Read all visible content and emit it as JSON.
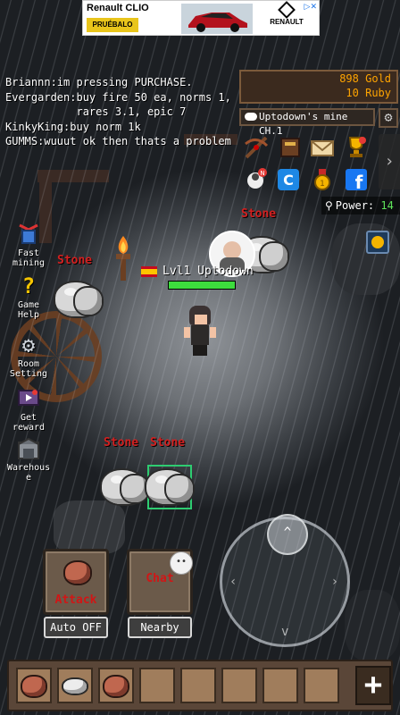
{
  "ad": {
    "brand_prefix": "Renault",
    "brand_model": "CLIO",
    "cta": "PRUÉBALO",
    "logo_text": "RENAULT"
  },
  "chat": {
    "lines": [
      "Briannn:im pressing PURCHASE.",
      "Evergarden:buy fire 50 ea, norms 1,",
      "           rares 3.1, epic 7",
      "KinkyKing:buy norm 1k",
      "GUMMS:wuuut ok then thats a problem"
    ]
  },
  "resources": {
    "gold": "898 Gold",
    "ruby": "10 Ruby"
  },
  "mine": {
    "name": "Uptodown's mine CH.1"
  },
  "power": {
    "label": "Power:",
    "value": "14"
  },
  "left_menu": [
    {
      "label": "Fast\nmining",
      "icon": "pickaxe-cube-icon"
    },
    {
      "label": "Game\nHelp",
      "icon": "question-mark-icon"
    },
    {
      "label": "Room\nSetting",
      "icon": "gear-icon"
    },
    {
      "label": "Get\nreward",
      "icon": "reward-video-icon"
    },
    {
      "label": "Warehous\ne",
      "icon": "warehouse-icon"
    }
  ],
  "top_icons": [
    "crossbow-icon",
    "book-icon",
    "mail-icon",
    "trophy-icon",
    "notification-icon",
    "c-badge-icon",
    "medal-icon",
    "facebook-icon"
  ],
  "map": {
    "stone_label": "Stone",
    "nameplate": "Lvl1 Uptodown",
    "hp_fraction": 1.0
  },
  "actions": {
    "attack_label": "Attack",
    "chat_label": "Chat",
    "auto_label": "Auto OFF",
    "nearby_label": "Nearby"
  },
  "hotbar": {
    "slots": [
      "red-ore",
      "white-stone",
      "red-ore",
      "",
      "",
      "",
      "",
      ""
    ],
    "plus": "+"
  },
  "colors": {
    "gold": "#ffa400",
    "stone_label": "#d32020",
    "hp": "#3ddc3d",
    "power_value": "#5fe35a"
  }
}
